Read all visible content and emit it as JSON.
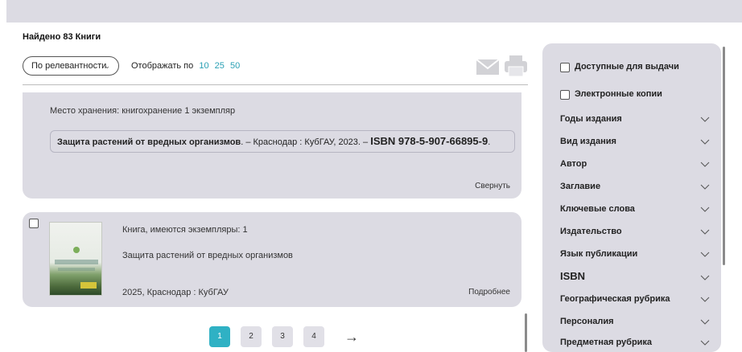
{
  "results": {
    "found_label": "Найдено 83 Книги"
  },
  "toolbar": {
    "sort_label": "По релевантности",
    "per_page_label": "Отображать по",
    "per_page_options": [
      "10",
      "25",
      "50"
    ]
  },
  "expanded_item": {
    "storage": "Место хранения: книгохранение 1 экземпляр",
    "citation_title": "Защита растений от вредных организмов",
    "citation_rest": ". – Краснодар : КубГАУ, 2023. – ",
    "citation_isbn": "ISBN 978-5-907-66895-9",
    "citation_end": ".",
    "collapse_label": "Свернуть"
  },
  "book_item": {
    "kind": "Книга, имеются экземпляры: 1",
    "title": "Защита растений от вредных организмов",
    "publication": "2025, Краснодар : КубГАУ",
    "more_label": "Подробнее"
  },
  "pagination": {
    "pages": [
      "1",
      "2",
      "3",
      "4"
    ],
    "current": "1",
    "next_arrow": "→"
  },
  "filters": {
    "checkboxes": [
      "Доступные для выдачи",
      "Электронные копии"
    ],
    "groups": [
      "Годы издания",
      "Вид издания",
      "Автор",
      "Заглавие",
      "Ключевые слова",
      "Издательство",
      "Язык публикации",
      "ISBN",
      "Географическая рубрика",
      "Персоналия",
      "Предметная рубрика"
    ]
  },
  "colors": {
    "accent": "#2fb1c4",
    "panel": "#dcdbe3",
    "link": "#2aa0b4"
  },
  "icons": {
    "mail": "mail-icon",
    "print": "print-icon",
    "chevron": "chevron-down-icon"
  }
}
